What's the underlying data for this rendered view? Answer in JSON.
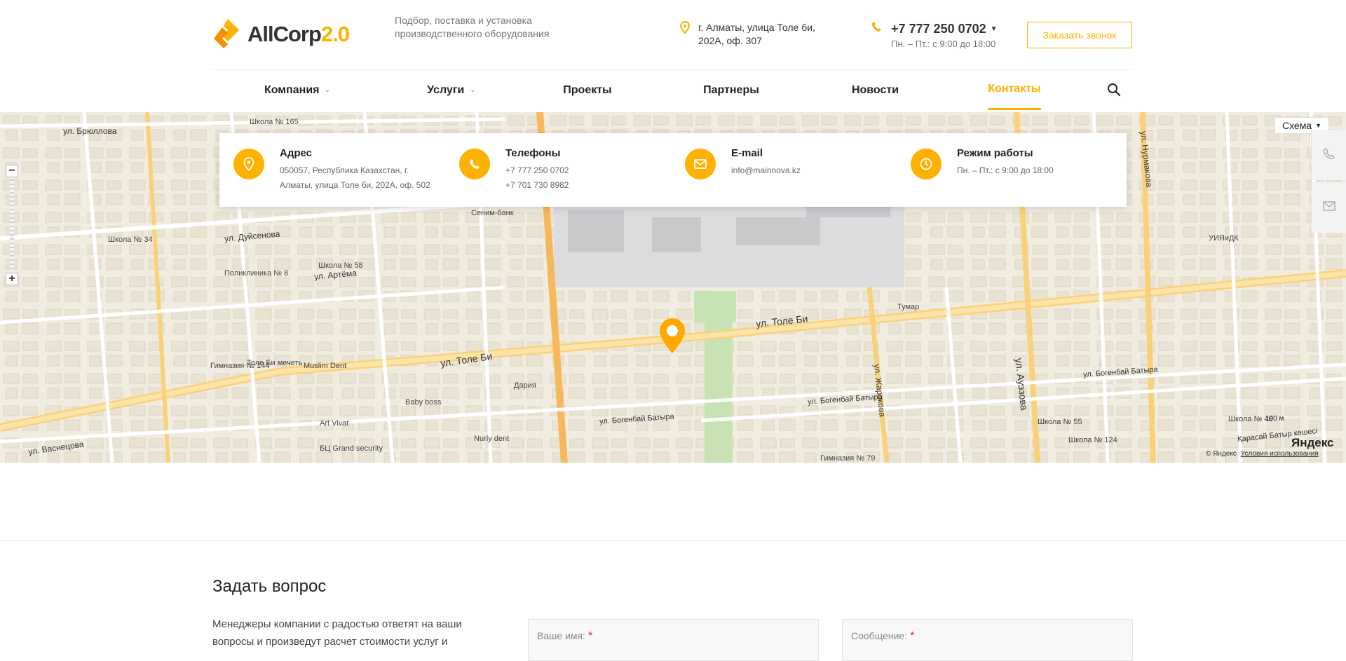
{
  "header": {
    "logo_text_1": "AllCorp",
    "logo_text_2": "2.0",
    "slogan": "Подбор, поставка и установка производственного оборудования",
    "address": "г. Алматы, улица Толе би, 202А, оф. 307",
    "phone": "+7 777 250 0702",
    "hours": "Пн. – Пт.: с 9:00 до 18:00",
    "callback_label": "Заказать звонок"
  },
  "nav": {
    "items": [
      {
        "label": "Компания",
        "has_dropdown": true
      },
      {
        "label": "Услуги",
        "has_dropdown": true
      },
      {
        "label": "Проекты",
        "has_dropdown": false
      },
      {
        "label": "Партнеры",
        "has_dropdown": false
      },
      {
        "label": "Новости",
        "has_dropdown": false
      },
      {
        "label": "Контакты",
        "has_dropdown": false,
        "active": true
      }
    ]
  },
  "contact_card": {
    "address_title": "Адрес",
    "address_line1": "050057, Республика Казахстан, г.",
    "address_line2": "Алматы, улица Толе би, 202А, оф. 502",
    "phones_title": "Телефоны",
    "phone1": "+7 777 250 0702",
    "phone2": "+7 701 730 8982",
    "email_title": "E-mail",
    "email": "info@mainnova.kz",
    "hours_title": "Режим работы",
    "hours": "Пн. – Пт.: с 9:00 до 18:00"
  },
  "map": {
    "schema_label": "Схема",
    "yandex_logo": "Яндекс",
    "copyright": "© Яндекс",
    "terms": "Условия использования",
    "scale": "100 м",
    "streets": {
      "tole_bi_1": "ул. Толе Би",
      "tole_bi_2": "ул. Толе Би",
      "bryullova": "ул. Брюллова",
      "duysenova": "ул. Дуйсенова",
      "artema": "ул. Артёма",
      "vasnetsova": "ул. Васнецова",
      "bogenbay_1": "ул. Богенбай Батыра",
      "bogenbay_2": "ул. Богенбай Батыра",
      "bogenbay_3": "ул. Богенбай Батыра",
      "karasay": "Қарасай Батыр көшесі",
      "auezova": "ул. Ауэзова",
      "zharokova": "ул. Жарокова",
      "nurmakova": "ул. Нурмакова"
    },
    "pois": [
      "Школа № 165",
      "Школа № 34",
      "Поликлиника № 8",
      "Школа № 58",
      "Сеним-банк",
      "Гимназия № 144",
      "Толе Би мечеть",
      "Muslim Dent",
      "Art Vivat",
      "БЦ Grand security",
      "Baby boss",
      "Дария",
      "Nurly dent",
      "Тумар",
      "Школа № 55",
      "Школа № 124",
      "Школа № 46",
      "Гимназия № 79",
      "УИЯиДК"
    ]
  },
  "ask": {
    "title": "Задать вопрос",
    "text": "Менеджеры компании с радостью ответят на ваши вопросы и произведут расчет стоимости услуг и",
    "name_label": "Ваше имя:",
    "message_label": "Сообщение:",
    "required_mark": "*"
  },
  "colors": {
    "accent": "#ffb100",
    "text": "#222222",
    "muted": "#777777",
    "map_bg": "#f1ece0",
    "road_major": "#f9d17a",
    "required": "#e0282e"
  }
}
